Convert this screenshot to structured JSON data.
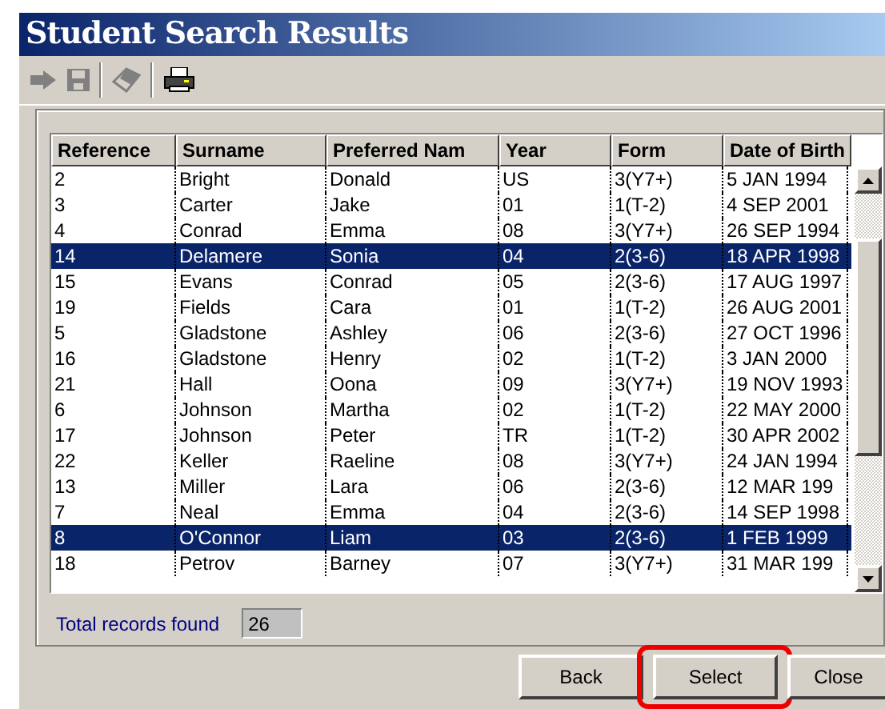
{
  "window": {
    "title": "Student Search Results"
  },
  "toolbar": [
    {
      "kind": "back",
      "disabled": true
    },
    {
      "kind": "save",
      "disabled": true
    },
    {
      "kind": "erase",
      "disabled": true
    },
    {
      "kind": "print",
      "disabled": false
    }
  ],
  "table": {
    "columns": [
      "Reference",
      "Surname",
      "Preferred Nam",
      "Year",
      "Form",
      "Date of Birth"
    ],
    "rows": [
      {
        "cells": [
          "2",
          "Bright",
          "Donald",
          "US",
          "3(Y7+)",
          "5 JAN 1994"
        ],
        "selected": false
      },
      {
        "cells": [
          "3",
          "Carter",
          "Jake",
          "01",
          "1(T-2)",
          "4 SEP 2001"
        ],
        "selected": false
      },
      {
        "cells": [
          "4",
          "Conrad",
          "Emma",
          "08",
          "3(Y7+)",
          "26 SEP 1994"
        ],
        "selected": false
      },
      {
        "cells": [
          "14",
          "Delamere",
          "Sonia",
          "04",
          "2(3-6)",
          "18 APR 1998"
        ],
        "selected": true
      },
      {
        "cells": [
          "15",
          "Evans",
          "Conrad",
          "05",
          "2(3-6)",
          "17 AUG 1997"
        ],
        "selected": false
      },
      {
        "cells": [
          "19",
          "Fields",
          "Cara",
          "01",
          "1(T-2)",
          "26 AUG 2001"
        ],
        "selected": false
      },
      {
        "cells": [
          "5",
          "Gladstone",
          "Ashley",
          "06",
          "2(3-6)",
          "27 OCT 1996"
        ],
        "selected": false
      },
      {
        "cells": [
          "16",
          "Gladstone",
          "Henry",
          "02",
          "1(T-2)",
          "3 JAN 2000"
        ],
        "selected": false
      },
      {
        "cells": [
          "21",
          "Hall",
          "Oona",
          "09",
          "3(Y7+)",
          "19 NOV 1993"
        ],
        "selected": false
      },
      {
        "cells": [
          "6",
          "Johnson",
          "Martha",
          "02",
          "1(T-2)",
          "22 MAY 2000"
        ],
        "selected": false
      },
      {
        "cells": [
          "17",
          "Johnson",
          "Peter",
          "TR",
          "1(T-2)",
          "30 APR 2002"
        ],
        "selected": false
      },
      {
        "cells": [
          "22",
          "Keller",
          "Raeline",
          "08",
          "3(Y7+)",
          "24 JAN 1994"
        ],
        "selected": false
      },
      {
        "cells": [
          "13",
          "Miller",
          "Lara",
          "06",
          "2(3-6)",
          "12 MAR 199"
        ],
        "selected": false
      },
      {
        "cells": [
          "7",
          "Neal",
          "Emma",
          "04",
          "2(3-6)",
          "14 SEP 1998"
        ],
        "selected": false
      },
      {
        "cells": [
          "8",
          "O'Connor",
          "Liam",
          "03",
          "2(3-6)",
          "1 FEB 1999"
        ],
        "selected": true
      },
      {
        "cells": [
          "18",
          "Petrov",
          "Barney",
          "07",
          "3(Y7+)",
          "31 MAR 199"
        ],
        "selected": false
      }
    ]
  },
  "total": {
    "label": "Total records found",
    "value": "26"
  },
  "buttons": [
    {
      "label": "Back",
      "highlighted": false
    },
    {
      "label": "Select",
      "highlighted": true
    },
    {
      "label": "Close",
      "highlighted": false
    }
  ]
}
